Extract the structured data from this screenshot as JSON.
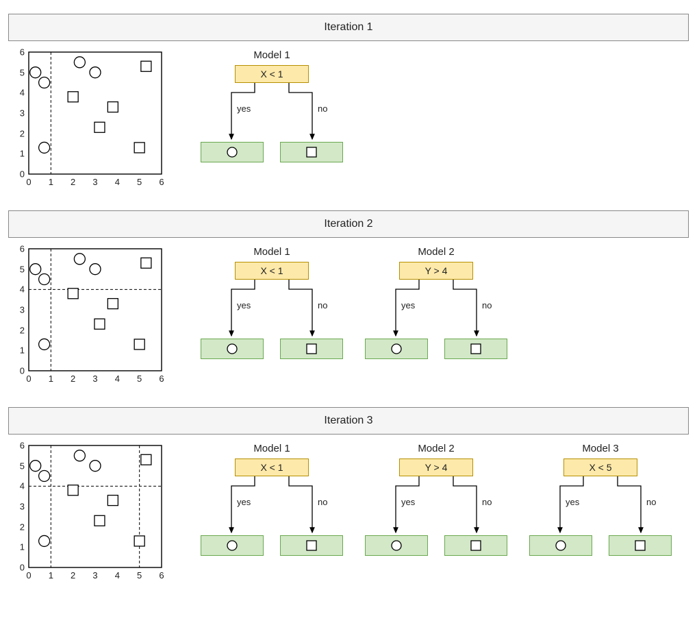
{
  "chart_data": [
    {
      "type": "scatter",
      "title": "Iteration 1",
      "xlim": [
        0,
        6
      ],
      "ylim": [
        0,
        6
      ],
      "xticks": [
        0,
        1,
        2,
        3,
        4,
        5,
        6
      ],
      "yticks": [
        0,
        1,
        2,
        3,
        4,
        5,
        6
      ],
      "points": {
        "circle": [
          [
            0.3,
            5.0
          ],
          [
            0.7,
            4.5
          ],
          [
            0.7,
            1.3
          ],
          [
            2.3,
            5.5
          ],
          [
            3.0,
            5.0
          ]
        ],
        "square": [
          [
            2.0,
            3.8
          ],
          [
            3.2,
            2.3
          ],
          [
            3.8,
            3.3
          ],
          [
            5.0,
            1.3
          ],
          [
            5.3,
            5.3
          ]
        ]
      },
      "split_lines": [
        {
          "axis": "v",
          "value": 1
        }
      ]
    },
    {
      "type": "scatter",
      "title": "Iteration 2",
      "xlim": [
        0,
        6
      ],
      "ylim": [
        0,
        6
      ],
      "xticks": [
        0,
        1,
        2,
        3,
        4,
        5,
        6
      ],
      "yticks": [
        0,
        1,
        2,
        3,
        4,
        5,
        6
      ],
      "points": {
        "circle": [
          [
            0.3,
            5.0
          ],
          [
            0.7,
            4.5
          ],
          [
            0.7,
            1.3
          ],
          [
            2.3,
            5.5
          ],
          [
            3.0,
            5.0
          ]
        ],
        "square": [
          [
            2.0,
            3.8
          ],
          [
            3.2,
            2.3
          ],
          [
            3.8,
            3.3
          ],
          [
            5.0,
            1.3
          ],
          [
            5.3,
            5.3
          ]
        ]
      },
      "split_lines": [
        {
          "axis": "v",
          "value": 1
        },
        {
          "axis": "h",
          "value": 4
        }
      ]
    },
    {
      "type": "scatter",
      "title": "Iteration 3",
      "xlim": [
        0,
        6
      ],
      "ylim": [
        0,
        6
      ],
      "xticks": [
        0,
        1,
        2,
        3,
        4,
        5,
        6
      ],
      "yticks": [
        0,
        1,
        2,
        3,
        4,
        5,
        6
      ],
      "points": {
        "circle": [
          [
            0.3,
            5.0
          ],
          [
            0.7,
            4.5
          ],
          [
            0.7,
            1.3
          ],
          [
            2.3,
            5.5
          ],
          [
            3.0,
            5.0
          ]
        ],
        "square": [
          [
            2.0,
            3.8
          ],
          [
            3.2,
            2.3
          ],
          [
            3.8,
            3.3
          ],
          [
            5.0,
            1.3
          ],
          [
            5.3,
            5.3
          ]
        ]
      },
      "split_lines": [
        {
          "axis": "v",
          "value": 1
        },
        {
          "axis": "h",
          "value": 4
        },
        {
          "axis": "v",
          "value": 5
        }
      ]
    }
  ],
  "iterations": [
    {
      "header": "Iteration 1",
      "trees": [
        {
          "title": "Model 1",
          "condition": "X < 1",
          "yes_label": "yes",
          "no_label": "no",
          "yes_leaf": "circle",
          "no_leaf": "square"
        }
      ]
    },
    {
      "header": "Iteration 2",
      "trees": [
        {
          "title": "Model 1",
          "condition": "X < 1",
          "yes_label": "yes",
          "no_label": "no",
          "yes_leaf": "circle",
          "no_leaf": "square"
        },
        {
          "title": "Model 2",
          "condition": "Y > 4",
          "yes_label": "yes",
          "no_label": "no",
          "yes_leaf": "circle",
          "no_leaf": "square"
        }
      ]
    },
    {
      "header": "Iteration 3",
      "trees": [
        {
          "title": "Model 1",
          "condition": "X < 1",
          "yes_label": "yes",
          "no_label": "no",
          "yes_leaf": "circle",
          "no_leaf": "square"
        },
        {
          "title": "Model 2",
          "condition": "Y > 4",
          "yes_label": "yes",
          "no_label": "no",
          "yes_leaf": "circle",
          "no_leaf": "square"
        },
        {
          "title": "Model 3",
          "condition": "X < 5",
          "yes_label": "yes",
          "no_label": "no",
          "yes_leaf": "circle",
          "no_leaf": "square"
        }
      ]
    }
  ]
}
